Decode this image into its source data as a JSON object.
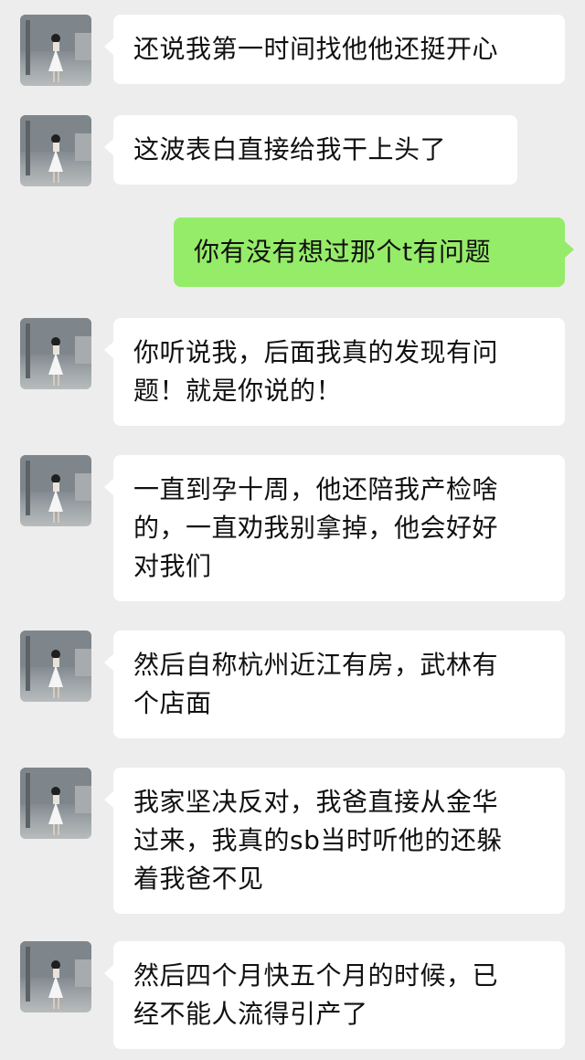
{
  "chat": {
    "messages": [
      {
        "side": "in",
        "text": "还说我第一时间找他他还挺开心"
      },
      {
        "side": "in",
        "text": "这波表白直接给我干上头了"
      },
      {
        "side": "out",
        "text": "你有没有想过那个t有问题"
      },
      {
        "side": "in",
        "text": "你听说我，后面我真的发现有问\n题！就是你说的！"
      },
      {
        "side": "in",
        "text": "一直到孕十周，他还陪我产检啥\n的，一直劝我别拿掉，他会好好\n对我们"
      },
      {
        "side": "in",
        "text": "然后自称杭州近江有房，武林有\n个店面"
      },
      {
        "side": "in",
        "text": "我家坚决反对，我爸直接从金华\n过来，我真的sb当时听他的还躲\n着我爸不见"
      },
      {
        "side": "in",
        "text": "然后四个月快五个月的时候，已\n经不能人流得引产了"
      }
    ]
  },
  "colors": {
    "background": "#ededed",
    "incoming_bubble": "#ffffff",
    "outgoing_bubble": "#95ec69",
    "text": "#111111"
  },
  "icons": {
    "avatar": "contact-avatar-photo"
  }
}
